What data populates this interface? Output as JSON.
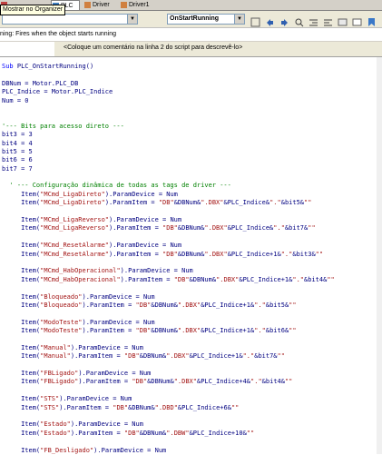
{
  "tabs": [
    {
      "label": "Mostrar no Organizer",
      "id": "t1"
    },
    {
      "label": "PLC",
      "id": "t2"
    },
    {
      "label": "Driver",
      "id": "t3"
    },
    {
      "label": "Driver1",
      "id": "t4"
    }
  ],
  "tooltip": "Mostrar no Organizer",
  "toolbar": {
    "object_combo": "",
    "event_combo": "OnStartRunning"
  },
  "description": "ning: Fires when the object starts running",
  "comment_placeholder": "<Coloque um comentário na linha 2 do script para descrevê-lo>",
  "code_lines": [
    [
      [
        "kw",
        "Sub"
      ],
      [
        "pl",
        " PLC_OnStartRunning()"
      ]
    ],
    [],
    [
      [
        "pl",
        "DBNum = Motor.PLC_DB"
      ]
    ],
    [
      [
        "pl",
        "PLC_Indice = Motor.PLC_Indice"
      ]
    ],
    [
      [
        "pl",
        "Num = 0"
      ]
    ],
    [],
    [],
    [
      [
        "cm",
        "'--- Bits para acesso direto ---"
      ]
    ],
    [
      [
        "pl",
        "bit3 = 3"
      ]
    ],
    [
      [
        "pl",
        "bit4 = 4"
      ]
    ],
    [
      [
        "pl",
        "bit5 = 5"
      ]
    ],
    [
      [
        "pl",
        "bit6 = 6"
      ]
    ],
    [
      [
        "pl",
        "bit7 = 7"
      ]
    ],
    [],
    [
      [
        "cm",
        "  ' --- Configuração dinâmica de todas as tags de driver ---"
      ]
    ],
    [
      [
        "pl",
        "     Item("
      ],
      [
        "str",
        "\"MCmd_LigaDireto\""
      ],
      [
        "pl",
        ").ParamDevice = Num"
      ]
    ],
    [
      [
        "pl",
        "     Item("
      ],
      [
        "str",
        "\"MCmd_LigaDireto\""
      ],
      [
        "pl",
        ").ParamItem = "
      ],
      [
        "str",
        "\"DB\""
      ],
      [
        "pl",
        "&DBNum&"
      ],
      [
        "str",
        "\".DBX\""
      ],
      [
        "pl",
        "&PLC_Indice&"
      ],
      [
        "str",
        "\".\""
      ],
      [
        "pl",
        "&bit5&"
      ],
      [
        "str",
        "\"\""
      ]
    ],
    [],
    [
      [
        "pl",
        "     Item("
      ],
      [
        "str",
        "\"MCmd_LigaReverso\""
      ],
      [
        "pl",
        ").ParamDevice = Num"
      ]
    ],
    [
      [
        "pl",
        "     Item("
      ],
      [
        "str",
        "\"MCmd_LigaReverso\""
      ],
      [
        "pl",
        ").ParamItem = "
      ],
      [
        "str",
        "\"DB\""
      ],
      [
        "pl",
        "&DBNum&"
      ],
      [
        "str",
        "\".DBX\""
      ],
      [
        "pl",
        "&PLC_Indice&"
      ],
      [
        "str",
        "\".\""
      ],
      [
        "pl",
        "&bit7&"
      ],
      [
        "str",
        "\"\""
      ]
    ],
    [],
    [
      [
        "pl",
        "     Item("
      ],
      [
        "str",
        "\"MCmd_ResetAlarme\""
      ],
      [
        "pl",
        ").ParamDevice = Num"
      ]
    ],
    [
      [
        "pl",
        "     Item("
      ],
      [
        "str",
        "\"MCmd_ResetAlarme\""
      ],
      [
        "pl",
        ").ParamItem = "
      ],
      [
        "str",
        "\"DB\""
      ],
      [
        "pl",
        "&DBNum&"
      ],
      [
        "str",
        "\".DBX\""
      ],
      [
        "pl",
        "&PLC_Indice+1&"
      ],
      [
        "str",
        "\".\""
      ],
      [
        "pl",
        "&bit3&"
      ],
      [
        "str",
        "\"\""
      ]
    ],
    [],
    [
      [
        "pl",
        "     Item("
      ],
      [
        "str",
        "\"MCmd_HabOperacional\""
      ],
      [
        "pl",
        ").ParamDevice = Num"
      ]
    ],
    [
      [
        "pl",
        "     Item("
      ],
      [
        "str",
        "\"MCmd_HabOperacional\""
      ],
      [
        "pl",
        ").ParamItem = "
      ],
      [
        "str",
        "\"DB\""
      ],
      [
        "pl",
        "&DBNum&"
      ],
      [
        "str",
        "\".DBX\""
      ],
      [
        "pl",
        "&PLC_Indice+1&"
      ],
      [
        "str",
        "\".\""
      ],
      [
        "pl",
        "&bit4&"
      ],
      [
        "str",
        "\"\""
      ]
    ],
    [],
    [
      [
        "pl",
        "     Item("
      ],
      [
        "str",
        "\"Bloqueado\""
      ],
      [
        "pl",
        ").ParamDevice = Num"
      ]
    ],
    [
      [
        "pl",
        "     Item("
      ],
      [
        "str",
        "\"Bloqueado\""
      ],
      [
        "pl",
        ").ParamItem = "
      ],
      [
        "str",
        "\"DB\""
      ],
      [
        "pl",
        "&DBNum&"
      ],
      [
        "str",
        "\".DBX\""
      ],
      [
        "pl",
        "&PLC_Indice+1&"
      ],
      [
        "str",
        "\".\""
      ],
      [
        "pl",
        "&bit5&"
      ],
      [
        "str",
        "\"\""
      ]
    ],
    [],
    [
      [
        "pl",
        "     Item("
      ],
      [
        "str",
        "\"ModoTeste\""
      ],
      [
        "pl",
        ").ParamDevice = Num"
      ]
    ],
    [
      [
        "pl",
        "     Item("
      ],
      [
        "str",
        "\"ModoTeste\""
      ],
      [
        "pl",
        ").ParamItem = "
      ],
      [
        "str",
        "\"DB\""
      ],
      [
        "pl",
        "&DBNum&"
      ],
      [
        "str",
        "\".DBX\""
      ],
      [
        "pl",
        "&PLC_Indice+1&"
      ],
      [
        "str",
        "\".\""
      ],
      [
        "pl",
        "&bit6&"
      ],
      [
        "str",
        "\"\""
      ]
    ],
    [],
    [
      [
        "pl",
        "     Item("
      ],
      [
        "str",
        "\"Manual\""
      ],
      [
        "pl",
        ").ParamDevice = Num"
      ]
    ],
    [
      [
        "pl",
        "     Item("
      ],
      [
        "str",
        "\"Manual\""
      ],
      [
        "pl",
        ").ParamItem = "
      ],
      [
        "str",
        "\"DB\""
      ],
      [
        "pl",
        "&DBNum&"
      ],
      [
        "str",
        "\".DBX\""
      ],
      [
        "pl",
        "&PLC_Indice+1&"
      ],
      [
        "str",
        "\".\""
      ],
      [
        "pl",
        "&bit7&"
      ],
      [
        "str",
        "\"\""
      ]
    ],
    [],
    [
      [
        "pl",
        "     Item("
      ],
      [
        "str",
        "\"FBLigado\""
      ],
      [
        "pl",
        ").ParamDevice = Num"
      ]
    ],
    [
      [
        "pl",
        "     Item("
      ],
      [
        "str",
        "\"FBLigado\""
      ],
      [
        "pl",
        ").ParamItem = "
      ],
      [
        "str",
        "\"DB\""
      ],
      [
        "pl",
        "&DBNum&"
      ],
      [
        "str",
        "\".DBX\""
      ],
      [
        "pl",
        "&PLC_Indice+4&"
      ],
      [
        "str",
        "\".\""
      ],
      [
        "pl",
        "&bit4&"
      ],
      [
        "str",
        "\"\""
      ]
    ],
    [],
    [
      [
        "pl",
        "     Item("
      ],
      [
        "str",
        "\"STS\""
      ],
      [
        "pl",
        ").ParamDevice = Num"
      ]
    ],
    [
      [
        "pl",
        "     Item("
      ],
      [
        "str",
        "\"STS\""
      ],
      [
        "pl",
        ").ParamItem = "
      ],
      [
        "str",
        "\"DB\""
      ],
      [
        "pl",
        "&DBNum&"
      ],
      [
        "str",
        "\".DBD\""
      ],
      [
        "pl",
        "&PLC_Indice+6&"
      ],
      [
        "str",
        "\"\""
      ]
    ],
    [],
    [
      [
        "pl",
        "     Item("
      ],
      [
        "str",
        "\"Estado\""
      ],
      [
        "pl",
        ").ParamDevice = Num"
      ]
    ],
    [
      [
        "pl",
        "     Item("
      ],
      [
        "str",
        "\"Estado\""
      ],
      [
        "pl",
        ").ParamItem = "
      ],
      [
        "str",
        "\"DB\""
      ],
      [
        "pl",
        "&DBNum&"
      ],
      [
        "str",
        "\".DBW\""
      ],
      [
        "pl",
        "&PLC_Indice+10&"
      ],
      [
        "str",
        "\"\""
      ]
    ],
    [],
    [
      [
        "pl",
        "     Item("
      ],
      [
        "str",
        "\"FB_Desligado\""
      ],
      [
        "pl",
        ").ParamDevice = Num"
      ]
    ]
  ],
  "colors": {
    "keyword": "#0000ff",
    "string": "#a31515",
    "comment": "#008000",
    "plain": "#000080",
    "toolbar_bg": "#ece9d8"
  }
}
